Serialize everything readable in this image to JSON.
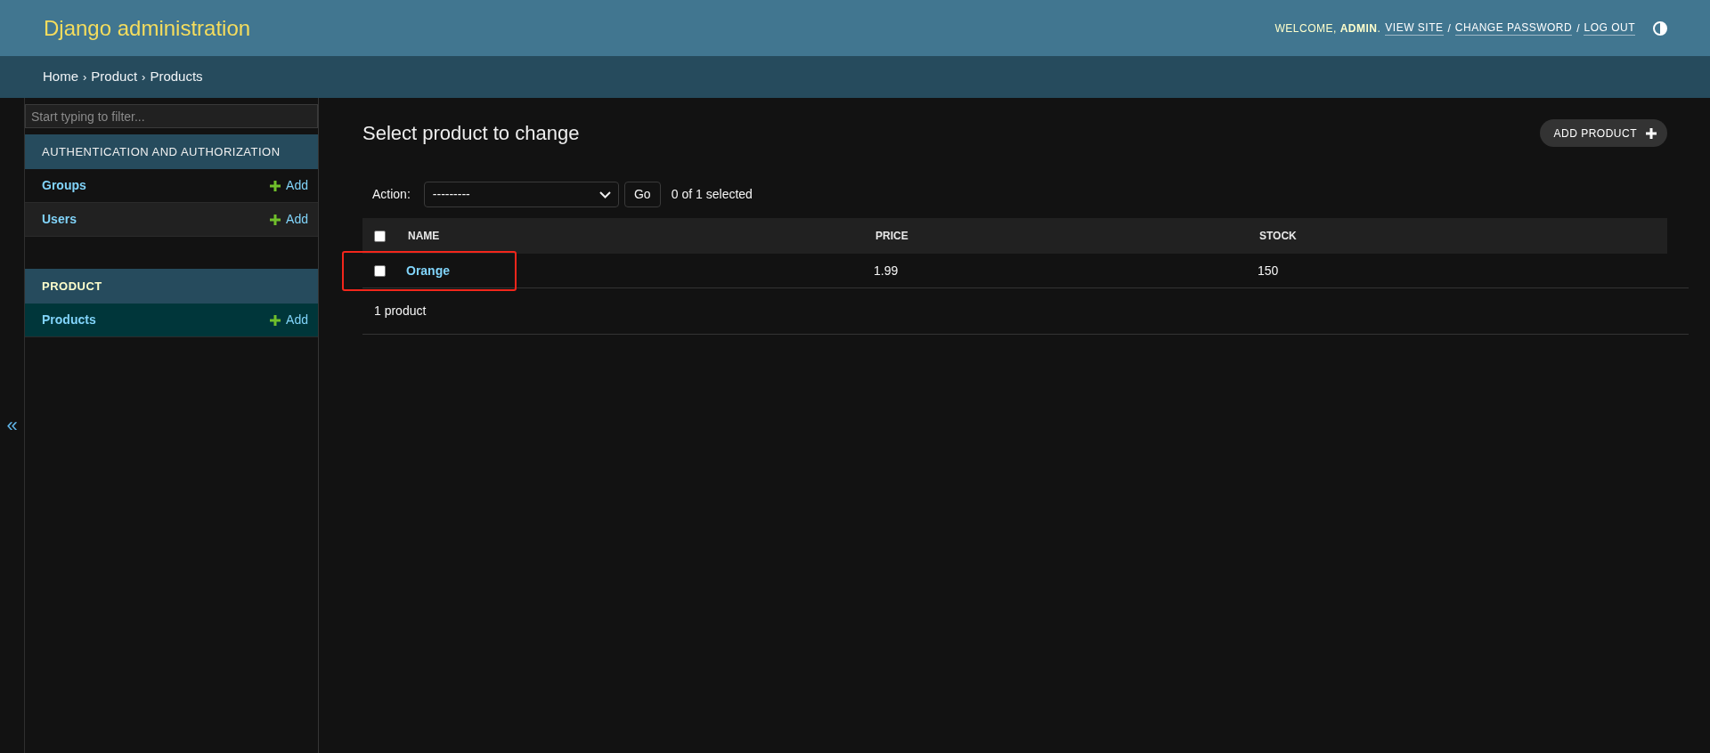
{
  "header": {
    "title": "Django administration",
    "welcome": "WELCOME, **ADMIN**.",
    "user_links": [
      {
        "kind": "link",
        "text": "VIEW SITE"
      },
      {
        "kind": "separator",
        "text": "/"
      },
      {
        "kind": "link",
        "text": "CHANGE PASSWORD"
      },
      {
        "kind": "separator",
        "text": "/"
      },
      {
        "kind": "link",
        "text": "LOG OUT"
      }
    ]
  },
  "breadcrumbs": [
    {
      "kind": "link",
      "text": "Home"
    },
    {
      "kind": "separator",
      "text": "›"
    },
    {
      "kind": "link",
      "text": "Product"
    },
    {
      "kind": "separator",
      "text": "›"
    },
    {
      "kind": "text",
      "text": "Products"
    }
  ],
  "sidebar": {
    "toggle": "«",
    "filter": {
      "placeholder": "Start typing to filter..."
    },
    "apps": [
      {
        "name": "AUTHENTICATION AND AUTHORIZATION",
        "selected": false,
        "models": [
          {
            "name": "Groups",
            "add": "Add",
            "selected": false
          },
          {
            "name": "Users",
            "add": "Add",
            "selected": false
          }
        ]
      },
      {
        "name": "PRODUCT",
        "selected": true,
        "models": [
          {
            "name": "Products",
            "add": "Add",
            "selected": true
          }
        ]
      }
    ]
  },
  "content": {
    "title": "Select product to change",
    "add_button": "ADD PRODUCT",
    "actions": {
      "label": "Action:",
      "value": "---------",
      "go": "Go",
      "counter": "0 of 1 selected"
    },
    "table": {
      "select_all_checked": false,
      "columns": [
        "NAME",
        "PRICE",
        "STOCK"
      ],
      "rows": [
        {
          "checked": false,
          "highlighted": true,
          "cells": [
            "Orange",
            "1.99",
            "150"
          ]
        }
      ]
    },
    "paginator": "1 product"
  }
}
